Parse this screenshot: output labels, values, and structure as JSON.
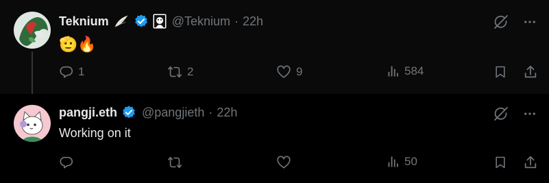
{
  "tweets": [
    {
      "name": "Teknium",
      "handle": "@Teknium",
      "dot": "·",
      "time": "22h",
      "text": "🫡🔥",
      "replies": "1",
      "retweets": "2",
      "likes": "9",
      "views": "584"
    },
    {
      "name": "pangji.eth",
      "handle": "@pangjieth",
      "dot": "·",
      "time": "22h",
      "text": "Working on it",
      "replies": "",
      "retweets": "",
      "likes": "",
      "views": "50"
    }
  ],
  "colors": {
    "verified": "#1d9bf0",
    "muted": "#71767b",
    "text": "#e7e9ea"
  },
  "icons": [
    "reply-icon",
    "retweet-icon",
    "like-icon",
    "views-icon",
    "bookmark-icon",
    "share-icon",
    "grok-icon",
    "more-icon",
    "verified-badge-icon",
    "wing-icon"
  ]
}
